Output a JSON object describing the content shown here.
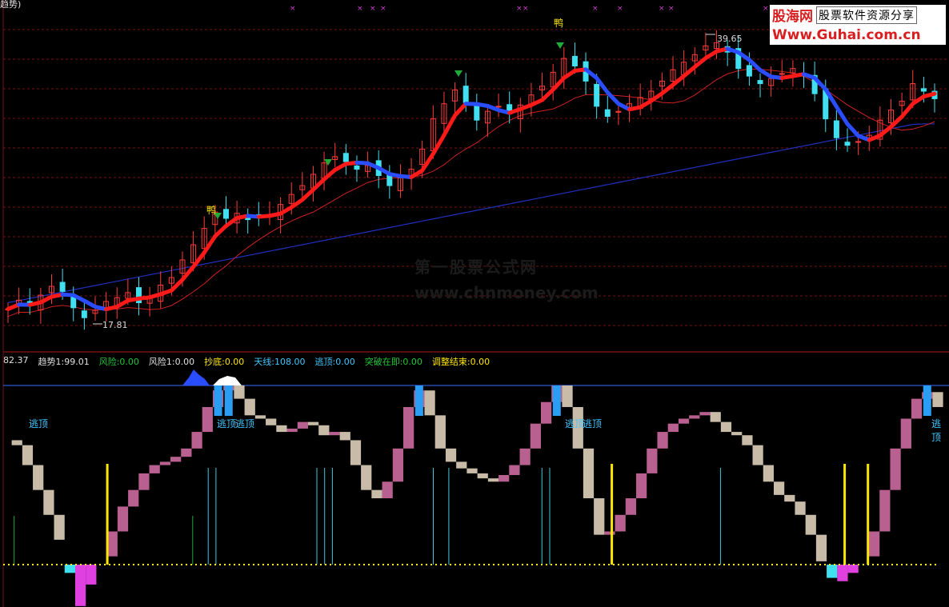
{
  "colors": {
    "background": "#000000",
    "up_candle": "#ff3b3b",
    "down_candle": "#40e0f0",
    "ma_fast_up": "#ff1a1a",
    "ma_fast_down": "#2a4dff",
    "ma_mid": "#d02020",
    "ma_slow": "#2030c0",
    "grid_line": "#7a1010",
    "separator": "#b01818",
    "osc_up": "#b8608f",
    "osc_down": "#c8bca8",
    "top_blue": "#2a9df4",
    "bottom_magenta": "#e040e0",
    "bottom_cyan": "#40e0f0",
    "signal_yellow": "#ffe600",
    "signal_cyan": "#40c8e0",
    "signal_green": "#1faa3a",
    "baseline_yellow": "#ffee22",
    "top_line": "#3a6cff"
  },
  "header_fragment": "趋势)",
  "watermark": {
    "site_cn": "股海网",
    "site_desc": "股票软件资源分享",
    "site_url": "Www.Guhai.com.cn",
    "center_cn": "第一股票公式网",
    "center_url": "www.chnmoney.com"
  },
  "price_labels": {
    "high": "39.65",
    "low": "17.81",
    "duck_mark": "鸭"
  },
  "lower_panel": {
    "left_value": "82.37",
    "indicators": [
      {
        "label": "趋势1:99.01",
        "color": "#e0e0e0"
      },
      {
        "label": "风险:0.00",
        "color": "#1fc83a"
      },
      {
        "label": "风险1:0.00",
        "color": "#e0e0e0"
      },
      {
        "label": "抄底:0.00",
        "color": "#ffe600"
      },
      {
        "label": "天线:108.00",
        "color": "#40c8ff"
      },
      {
        "label": "逃顶:0.00",
        "color": "#40c8ff"
      },
      {
        "label": "突破在即:0.00",
        "color": "#1fc83a"
      },
      {
        "label": "调整结束:0.00",
        "color": "#ffe600"
      }
    ],
    "top_label": "逃顶"
  },
  "chart_data": {
    "type": "candlestick+oscillator",
    "y_low_marked": 17.81,
    "y_high_marked": 39.65,
    "note_price_path": [
      18.5,
      19.2,
      18.8,
      19.6,
      20.3,
      19.9,
      18.6,
      17.81,
      18.4,
      19.1,
      19.4,
      19.8,
      19.0,
      19.5,
      20.4,
      21.0,
      22.4,
      23.6,
      24.9,
      26.2,
      25.7,
      26.1,
      25.6,
      25.9,
      26.0,
      26.8,
      27.6,
      28.3,
      29.2,
      30.1,
      30.6,
      30.2,
      29.6,
      29.9,
      29.1,
      28.3,
      28.9,
      29.6,
      31.2,
      33.6,
      34.8,
      35.9,
      34.9,
      33.5,
      34.2,
      34.6,
      34.0,
      34.7,
      35.5,
      36.2,
      37.3,
      38.4,
      37.8,
      36.6,
      34.6,
      33.8,
      34.2,
      34.8,
      35.3,
      35.8,
      36.6,
      37.5,
      38.1,
      38.7,
      39.4,
      39.65,
      38.9,
      37.6,
      37.0,
      36.4,
      36.8,
      37.2,
      37.6,
      37.0,
      35.6,
      33.6,
      32.1,
      31.5,
      31.8,
      32.3,
      33.5,
      34.3,
      35.0,
      36.4,
      35.8,
      35.2
    ],
    "oscillator": [
      75,
      72,
      60,
      45,
      30,
      15,
      -5,
      -25,
      -12,
      5,
      20,
      35,
      45,
      55,
      60,
      62,
      65,
      70,
      80,
      95,
      105,
      108,
      100,
      90,
      88,
      84,
      80,
      82,
      86,
      84,
      78,
      80,
      75,
      60,
      45,
      40,
      50,
      70,
      95,
      105,
      90,
      70,
      62,
      58,
      55,
      52,
      50,
      54,
      60,
      70,
      85,
      98,
      108,
      95,
      70,
      40,
      18,
      20,
      30,
      40,
      55,
      70,
      80,
      85,
      88,
      90,
      92,
      86,
      80,
      78,
      72,
      60,
      50,
      42,
      38,
      30,
      18,
      2,
      -8,
      -10,
      -5,
      5,
      20,
      45,
      70,
      88,
      100,
      104,
      95
    ],
    "signal_bars": [
      {
        "i": 1,
        "kind": "green"
      },
      {
        "i": 13,
        "kind": "yellow"
      },
      {
        "i": 24,
        "kind": "green"
      },
      {
        "i": 26,
        "kind": "cyan"
      },
      {
        "i": 27,
        "kind": "cyan"
      },
      {
        "i": 40,
        "kind": "cyan"
      },
      {
        "i": 41,
        "kind": "cyan"
      },
      {
        "i": 42,
        "kind": "cyan"
      },
      {
        "i": 55,
        "kind": "cyan"
      },
      {
        "i": 57,
        "kind": "cyan"
      },
      {
        "i": 69,
        "kind": "cyan"
      },
      {
        "i": 70,
        "kind": "cyan"
      },
      {
        "i": 78,
        "kind": "yellow"
      },
      {
        "i": 92,
        "kind": "cyan"
      },
      {
        "i": 108,
        "kind": "yellow"
      },
      {
        "i": 111,
        "kind": "yellow"
      }
    ]
  }
}
